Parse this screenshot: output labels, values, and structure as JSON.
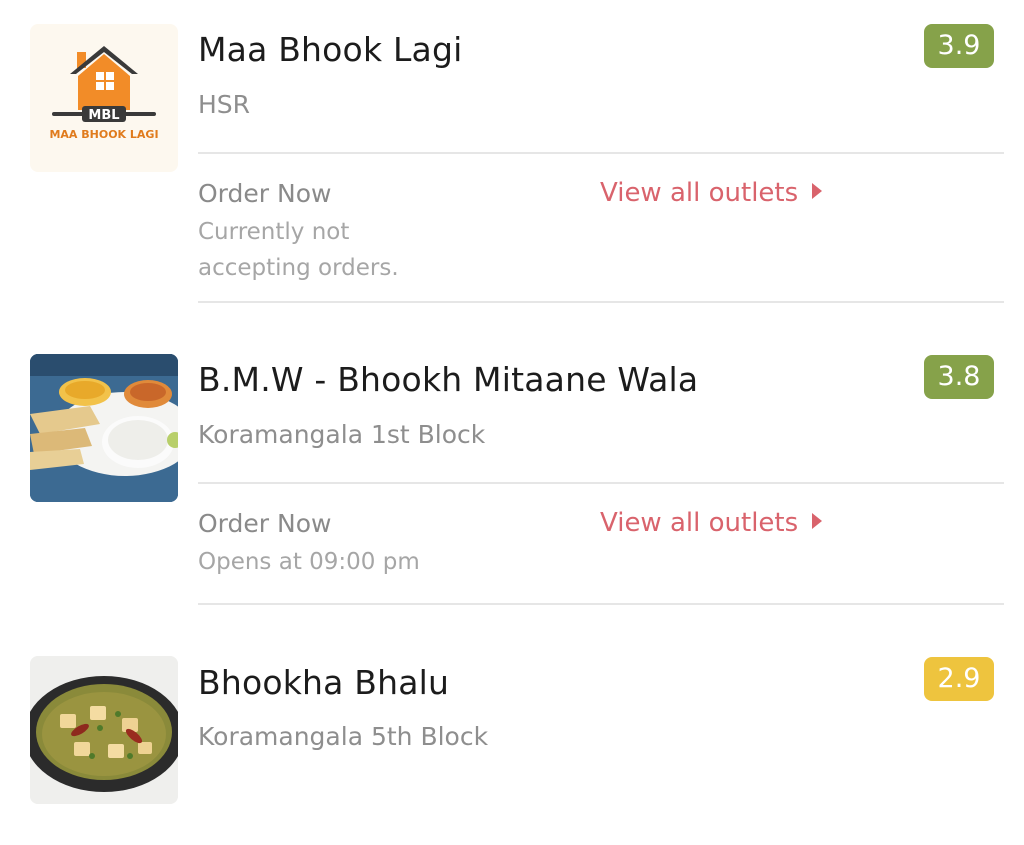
{
  "colors": {
    "rating_green": "#86a24a",
    "rating_yellow": "#eec43e",
    "accent_red": "#d9636c"
  },
  "restaurants": [
    {
      "name": "Maa Bhook Lagi",
      "location": "HSR",
      "rating": "3.9",
      "logo_text": "MBL",
      "logo_subtext": "MAA BHOOK LAGI",
      "order_label": "Order Now",
      "status": "Currently not accepting orders.",
      "outlets_label": "View all outlets"
    },
    {
      "name": "B.M.W - Bhookh Mitaane Wala",
      "location": "Koramangala 1st Block",
      "rating": "3.8",
      "order_label": "Order Now",
      "status": "Opens at 09:00 pm",
      "outlets_label": "View all outlets"
    },
    {
      "name": "Bhookha Bhalu",
      "location": "Koramangala 5th Block",
      "rating": "2.9"
    }
  ]
}
